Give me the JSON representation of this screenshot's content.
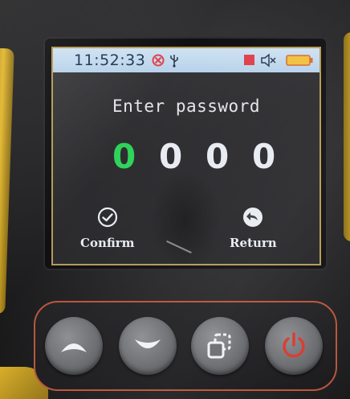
{
  "status_bar": {
    "time": "11:52:33",
    "icons": [
      "no-signal-icon",
      "usb-icon",
      "record-icon",
      "mute-icon",
      "battery-icon"
    ],
    "battery_color": "#f0c040",
    "record_color": "#e0404a"
  },
  "prompt": "Enter password",
  "digits": [
    "0",
    "0",
    "0",
    "0"
  ],
  "active_digit_color": "#2fd35a",
  "softkeys": {
    "confirm": {
      "label": "Confirm",
      "icon": "check-circle-icon"
    },
    "return": {
      "label": "Return",
      "icon": "return-arrow-icon"
    }
  },
  "hardware_buttons": [
    {
      "icon": "chevron-up-icon"
    },
    {
      "icon": "chevron-down-icon"
    },
    {
      "icon": "switch-squares-icon"
    },
    {
      "icon": "power-icon",
      "color": "#d83a2e"
    }
  ],
  "colors": {
    "status_bar": "#c4daee",
    "screen_border": "#b49a55",
    "panel_border": "#b8553a"
  }
}
